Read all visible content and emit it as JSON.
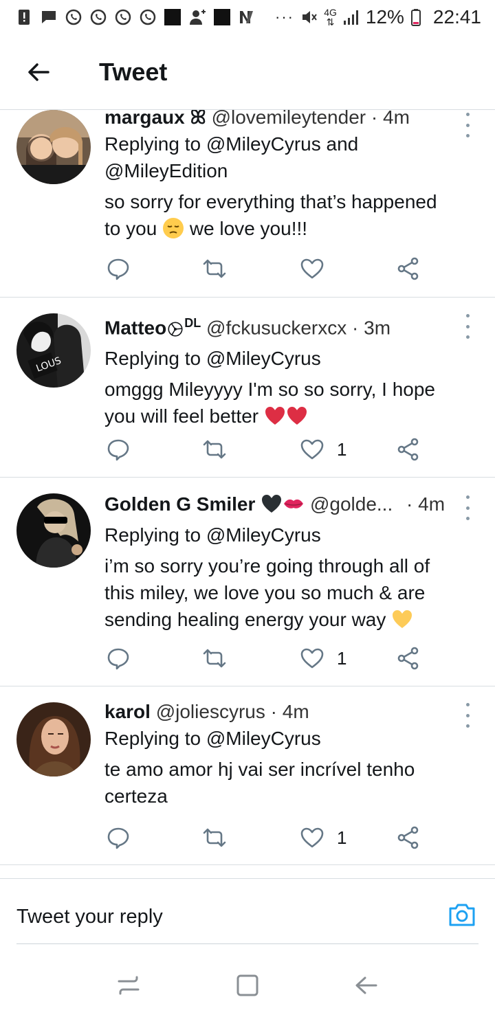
{
  "status_bar": {
    "battery": "12%",
    "time": "22:41",
    "network": "4G",
    "more": "···"
  },
  "header": {
    "title": "Tweet"
  },
  "tweets": [
    {
      "name": "margaux ꕤ",
      "handle": "@lovemileytender",
      "sep": " · ",
      "time": "4m",
      "reply_line1": "Replying to @MileyCyrus and",
      "reply_line2": "@MileyEdition",
      "text_line1": "so sorry for everything that’s happened",
      "text_before_emoji": "to you ",
      "text_after_emoji": " we love you!!!",
      "likes": ""
    },
    {
      "name": "Matteo",
      "name_suffix": "DL",
      "handle": "@fckusuckerxcx",
      "sep": " · ",
      "time": "3m",
      "reply_line1": "Replying to @MileyCyrus",
      "text_line1": "omggg Mileyyyy I'm so so sorry, I hope",
      "text_before_emoji": "you will feel better ",
      "likes": "1"
    },
    {
      "name": "Golden G Smiler",
      "handle": "@golde...",
      "sep": " · ",
      "time": "4m",
      "reply_line1": "Replying to @MileyCyrus",
      "text_line1": "i’m so sorry you’re going through all of",
      "text_line2": "this miley, we love you so much & are",
      "text_before_emoji": "sending healing energy your way ",
      "likes": "1"
    },
    {
      "name": "karol",
      "handle": "@joliescyrus",
      "sep": " · ",
      "time": "4m",
      "reply_line1": "Replying to @MileyCyrus",
      "text_line1": "te amo amor hj vai ser incrível tenho",
      "text_line2": "certeza",
      "likes": "1"
    }
  ],
  "reply_bar": {
    "placeholder": "Tweet your reply"
  },
  "colors": {
    "icon_gray": "#657786",
    "divider": "#d8dde1",
    "camera_blue": "#1da1f2",
    "heart_red": "#e0245e",
    "yellow_heart": "#ffcc4d"
  }
}
